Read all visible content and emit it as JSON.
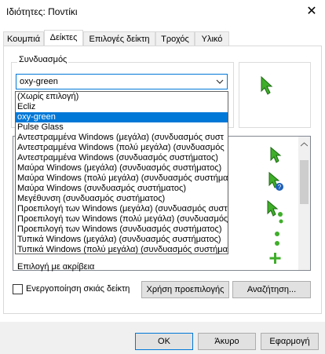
{
  "window": {
    "title": "Ιδιότητες: Ποντίκι",
    "close_label": "✕"
  },
  "tabs": [
    {
      "label": "Κουμπιά"
    },
    {
      "label": "Δείκτες"
    },
    {
      "label": "Επιλογές δείκτη"
    },
    {
      "label": "Τροχός"
    },
    {
      "label": "Υλικό"
    }
  ],
  "scheme": {
    "group_label": "Συνδυασμός",
    "selected_value": "oxy-green",
    "options": [
      "(Χωρίς επιλογή)",
      "Ecliz",
      "oxy-green",
      "Pulse Glass",
      "Αντεστραμμένα Windows (μεγάλα) (συνδυασμός συστ",
      "Αντεστραμμένα Windows (πολύ μεγάλα) (συνδυασμός",
      "Αντεστραμμένα Windows (συνδυασμός συστήματος)",
      "Μαύρα Windows (μεγάλα) (συνδυασμός συστήματος)",
      "Μαύρα Windows (πολύ μεγάλα) (συνδυασμός συστήματ",
      "Μαύρα Windows (συνδυασμός συστήματος)",
      "Μεγέθυνση (συνδυασμός συστήματος)",
      "Προεπιλογή των Windows (μεγάλα) (συνδυασμός συστ",
      "Προεπιλογή των Windows (πολύ μεγάλα) (συνδυασμός",
      "Προεπιλογή των Windows (συνδυασμός συστήματος)",
      "Τυπικά Windows (μεγάλα) (συνδυασμός συστήματος)",
      "Τυπικά Windows (πολύ μεγάλα) (συνδυασμός συστήμα"
    ],
    "selected_index": 2
  },
  "customize": {
    "visible_item_label": "Επιλογή με ακρίβεια"
  },
  "shadow_checkbox": {
    "label": "Ενεργοποίηση σκιάς δείκτη",
    "checked": false
  },
  "buttons": {
    "use_default": "Χρήση προεπιλογής",
    "browse": "Αναζήτηση...",
    "ok": "OK",
    "cancel": "Άκυρο",
    "apply": "Εφαρμογή"
  },
  "colors": {
    "accent": "#0078d7",
    "cursor_green": "#3fae2a"
  }
}
